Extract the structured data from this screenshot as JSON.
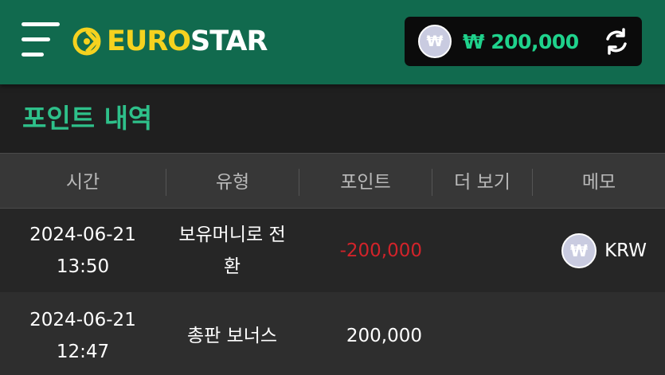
{
  "header": {
    "logo_euro": "EURO",
    "logo_star": "STAR",
    "balance": {
      "currency_icon": "won-coin-icon",
      "coin_symbol": "₩",
      "amount": "₩ 200,000"
    }
  },
  "page": {
    "title": "포인트 내역"
  },
  "table": {
    "columns": [
      "시간",
      "유형",
      "포인트",
      "더 보기",
      "메모"
    ],
    "rows": [
      {
        "date": "2024-06-21",
        "time": "13:50",
        "type_line1": "보유머니로 전",
        "type_line2": "환",
        "points": "-200,000",
        "more": "",
        "memo_coin": "₩",
        "memo": "KRW"
      },
      {
        "date": "2024-06-21",
        "time": "12:47",
        "type_line1": "총판 보너스",
        "type_line2": "",
        "points": "200,000",
        "more": "",
        "memo": ""
      }
    ]
  },
  "colors": {
    "header_bg": "#116a4e",
    "accent_green": "#2ec08a",
    "balance_green": "#1fd28c",
    "logo_yellow": "#f5d21f",
    "negative_red": "#d2232a"
  }
}
